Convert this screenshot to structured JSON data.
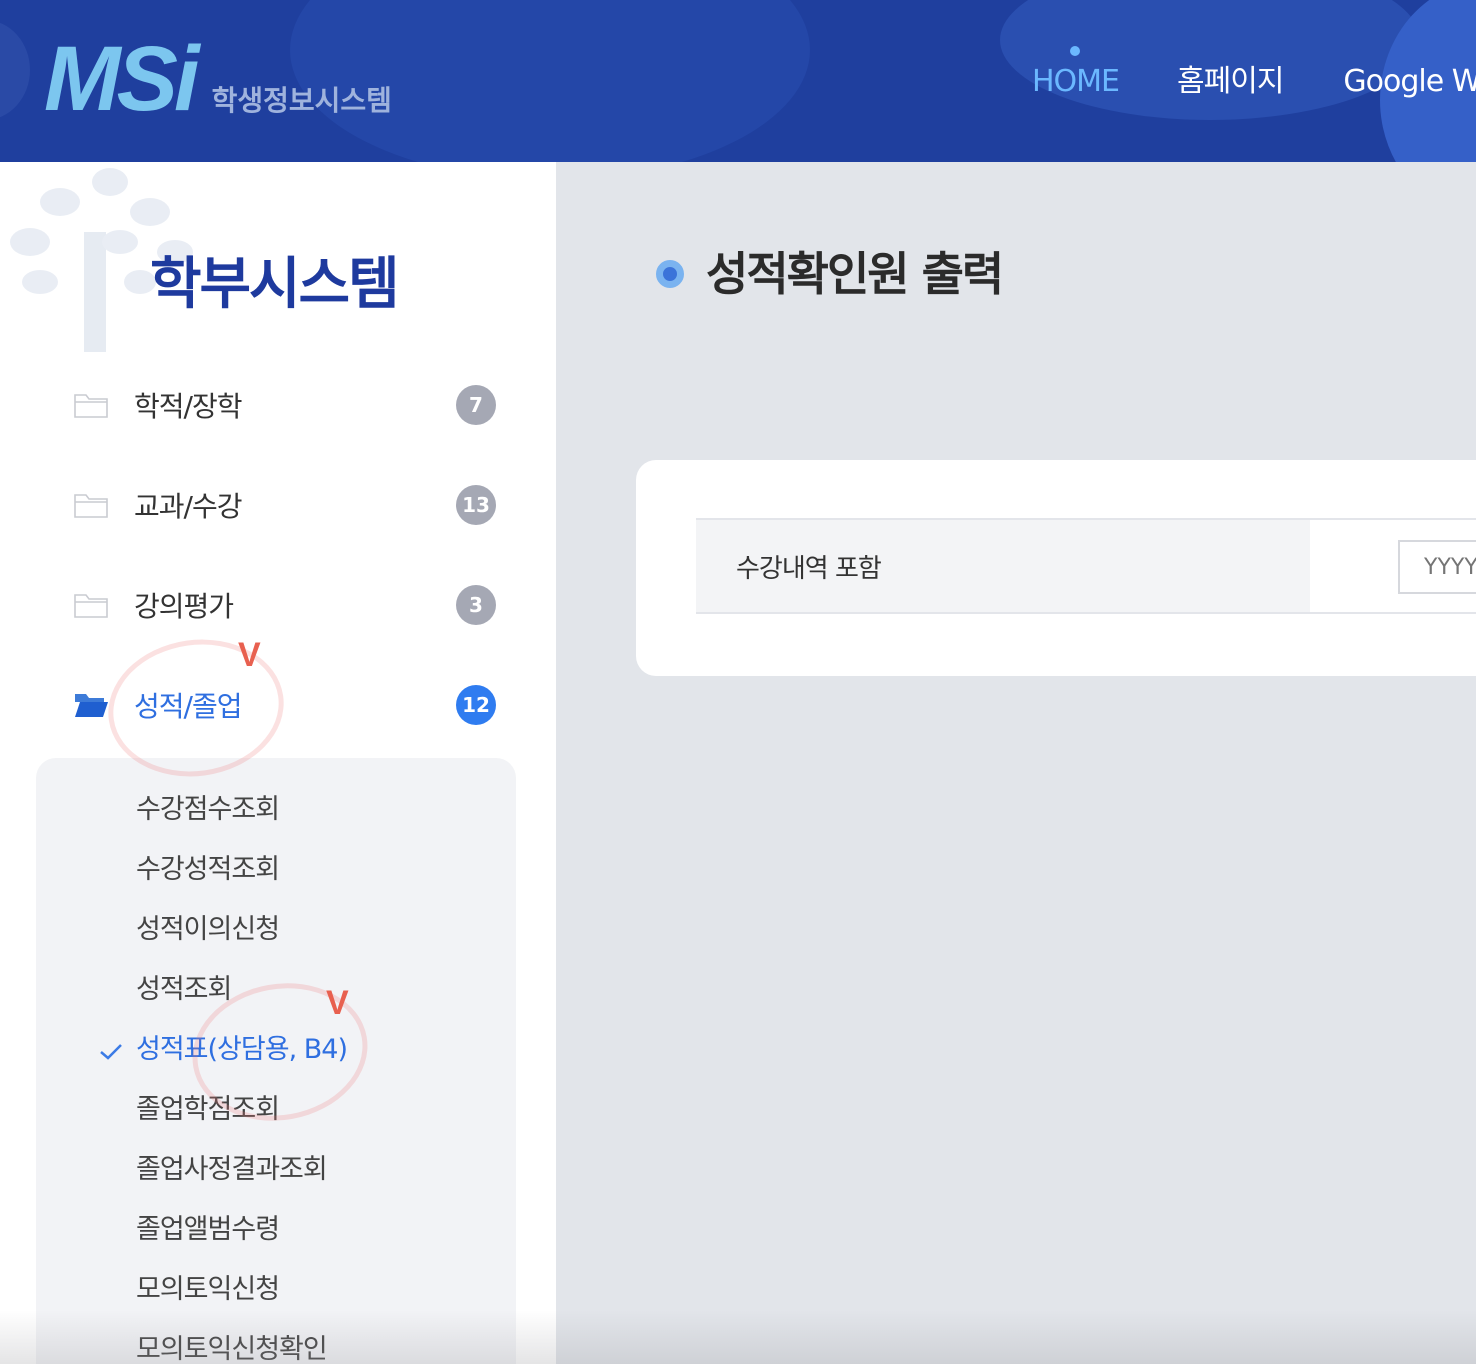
{
  "header": {
    "logo_mark": "MSi",
    "logo_subtitle": "학생정보시스템",
    "nav": {
      "home": "HOME",
      "homepage": "홈페이지",
      "google": "Google W"
    }
  },
  "sidebar": {
    "title": "학부시스템",
    "menu": [
      {
        "label": "학적/장학",
        "count": "7"
      },
      {
        "label": "교과/수강",
        "count": "13"
      },
      {
        "label": "강의평가",
        "count": "3"
      },
      {
        "label": "성적/졸업",
        "count": "12"
      }
    ],
    "submenu": [
      "수강점수조회",
      "수강성적조회",
      "성적이의신청",
      "성적조회",
      "성적표(상담용, B4)",
      "졸업학점조회",
      "졸업사정결과조회",
      "졸업앨범수령",
      "모의토익신청",
      "모의토익신청확인"
    ],
    "annotations": {
      "mark1": "V",
      "mark2": "V"
    }
  },
  "main": {
    "page_title": "성적확인원 출력",
    "form": {
      "label": "수강내역 포함",
      "date_placeholder": "YYYY"
    }
  },
  "colors": {
    "header_bg": "#1f3f9e",
    "accent": "#2f6fe0",
    "badge_gray": "#a5a8b4",
    "title_blue": "#1e3a9e"
  }
}
